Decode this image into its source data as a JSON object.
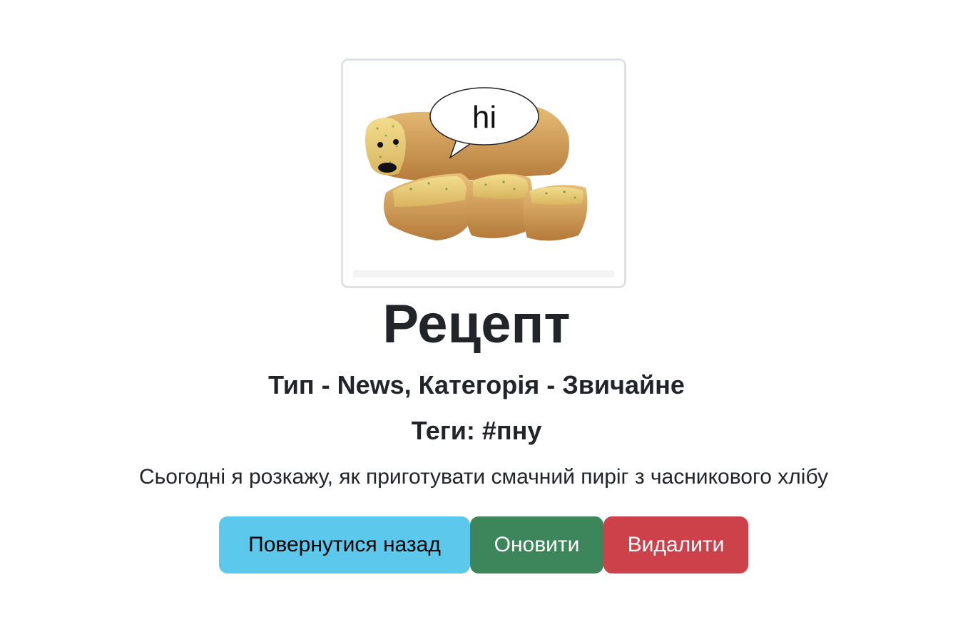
{
  "recipe": {
    "image": {
      "speech_bubble_text": "hi"
    },
    "title": "Рецепт",
    "meta": "Тип - News, Категорія - Звичайне",
    "tags": "Теги: #пну",
    "description": "Сьогодні я розкажу, як приготувати смачний пиріг з часникового хлібу"
  },
  "actions": {
    "back_label": "Повернутися назад",
    "update_label": "Оновити",
    "delete_label": "Видалити"
  },
  "colors": {
    "back_button": "#5bc8ec",
    "update_button": "#3d855a",
    "delete_button": "#cc414a",
    "text": "#212529"
  }
}
